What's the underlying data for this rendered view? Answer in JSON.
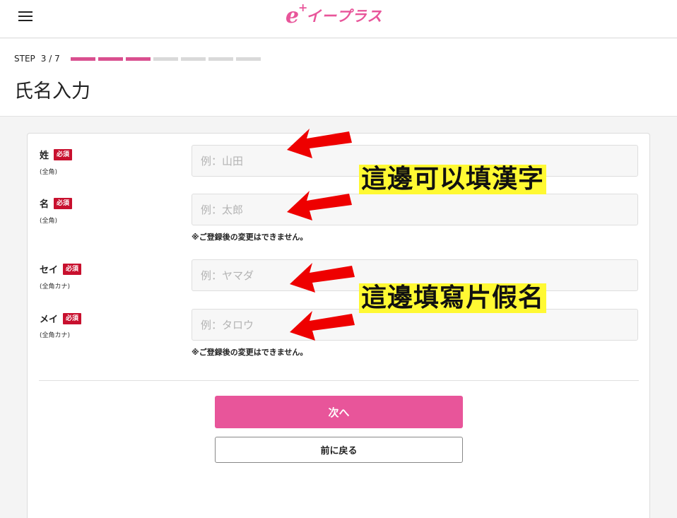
{
  "header": {
    "logo_mark": "e",
    "logo_plus": "+",
    "logo_text": "イープラス"
  },
  "progress": {
    "step_label": "STEP",
    "step_value": "3 / 7",
    "current": 3,
    "total": 7
  },
  "page_title": "氏名入力",
  "form": {
    "fields": [
      {
        "label": "姓",
        "required": "必須",
        "hint": "(全角)",
        "placeholder": "例：山田",
        "value": ""
      },
      {
        "label": "名",
        "required": "必須",
        "hint": "(全角)",
        "placeholder": "例：太郎",
        "value": ""
      },
      {
        "label": "セイ",
        "required": "必須",
        "hint": "(全角カナ)",
        "placeholder": "例：ヤマダ",
        "value": ""
      },
      {
        "label": "メイ",
        "required": "必須",
        "hint": "(全角カナ)",
        "placeholder": "例：タロウ",
        "value": ""
      }
    ],
    "note_kanji": "※ご登録後の変更はできません。",
    "note_kana": "※ご登録後の変更はできません。"
  },
  "buttons": {
    "next": "次へ",
    "back": "前に戻る"
  },
  "annotations": {
    "callout_kanji": "這邊可以填漢字",
    "callout_kana": "這邊填寫片假名",
    "arrow_color": "#ee0000",
    "highlight_color": "#fff933"
  },
  "colors": {
    "brand": "#e8559a",
    "required_badge": "#c8102e",
    "progress_active": "#d94f8f",
    "progress_inactive": "#d9d9d9"
  }
}
